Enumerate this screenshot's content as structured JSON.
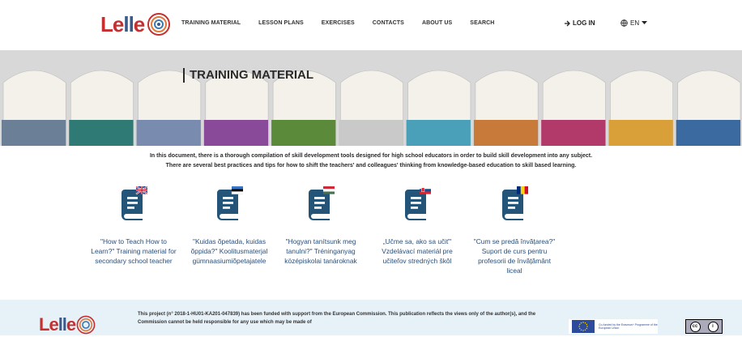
{
  "nav": {
    "logo_text_l": "Le",
    "logo_text_ll": "ll",
    "logo_text_e": "e",
    "items": [
      "TRAINING MATERIAL",
      "LESSON PLANS",
      "EXERCISES",
      "CONTACTS",
      "ABOUT US",
      "SEARCH"
    ],
    "login_label": "LOG IN",
    "lang_label": "EN"
  },
  "hero": {
    "title": "TRAINING MATERIAL",
    "spine_colors": [
      "#6b7f96",
      "#2f7a74",
      "#7a8bb0",
      "#8a4a9a",
      "#5b8a3a",
      "#c9c9c9",
      "#4aa0b8",
      "#c77a3a",
      "#b23a6a",
      "#d9a03a",
      "#3a6aa0"
    ]
  },
  "intro": {
    "line1": "In this document, there is a thorough compilation of skill development tools designed for high school educators in order to build skill development into any subject.",
    "line2": "There are several best practices and tips for how to shift the teachers' and colleagues' thinking from knowledge-based education to skill based learning."
  },
  "books": [
    {
      "flag": "uk",
      "caption": "\"How to Teach How to Learn?\" Training material for secondary school teacher"
    },
    {
      "flag": "ee",
      "caption": "\"Kuidas õpetada, kuidas õppida?\" Koolitusmaterjal gümnaasiumiõpetajatele"
    },
    {
      "flag": "hu",
      "caption": "\"Hogyan tanítsunk meg tanulni?\" Tréninganyag középiskolai tanároknak"
    },
    {
      "flag": "sk",
      "caption": "„Učme sa, ako sa učiť\" Vzdelávací materiál pre učiteľov stredných škôl"
    },
    {
      "flag": "ro",
      "caption": "\"Cum se predă învățarea?\" Suport de curs pentru profesorii de învățământ liceal"
    }
  ],
  "footer": {
    "text": "This project (n° 2018-1-HU01-KA201-047839) has been funded with support from the European Commission. This publication reflects the views only of the author(s), and the Commission cannot be held responsible for any use which may be made of",
    "eu_text": "Co-funded by the Erasmus+ Programme of the European Union",
    "colors": {
      "accent": "#2a4f7a",
      "book": "#245478",
      "footer_bg": "#e6f1f8"
    }
  }
}
